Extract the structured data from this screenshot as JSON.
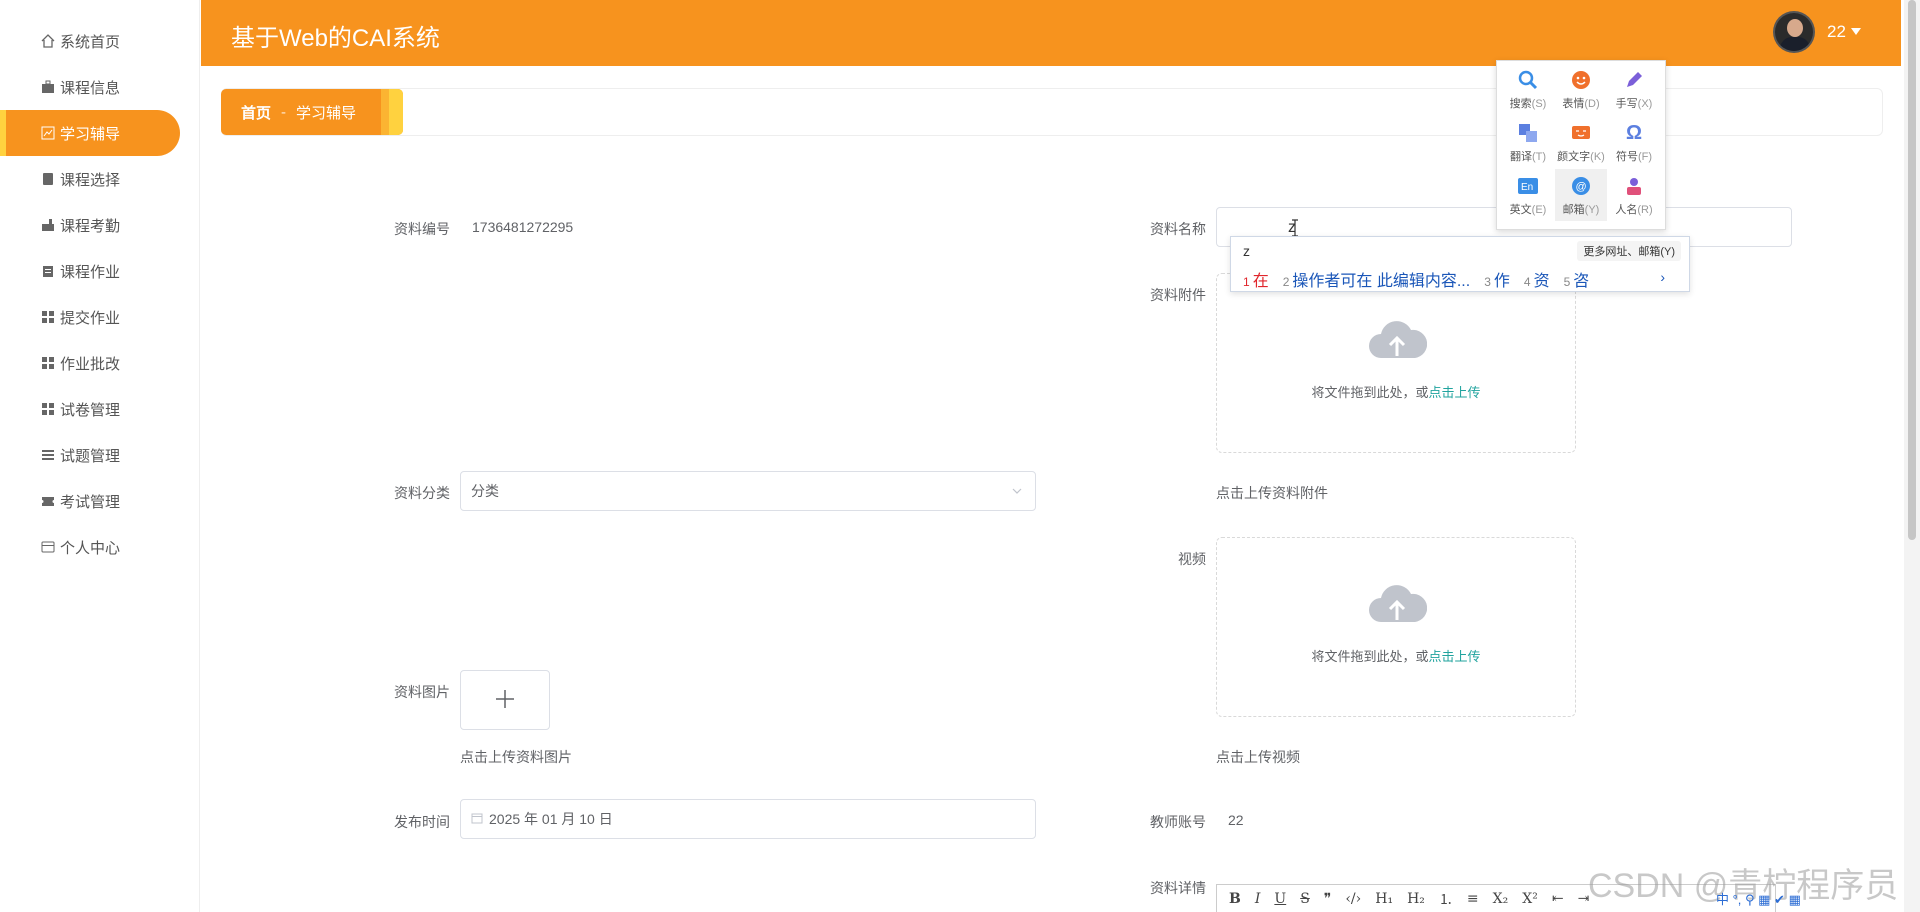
{
  "app": {
    "title": "基于Web的CAI系统",
    "username": "22"
  },
  "sidebar": {
    "items": [
      {
        "label": "系统首页",
        "icon": "home-icon"
      },
      {
        "label": "课程信息",
        "icon": "briefcase-icon"
      },
      {
        "label": "学习辅导",
        "icon": "chart-icon",
        "active": true
      },
      {
        "label": "课程选择",
        "icon": "book-icon"
      },
      {
        "label": "课程考勤",
        "icon": "stamp-icon"
      },
      {
        "label": "课程作业",
        "icon": "clipboard-icon"
      },
      {
        "label": "提交作业",
        "icon": "grid-icon"
      },
      {
        "label": "作业批改",
        "icon": "grid-icon"
      },
      {
        "label": "试卷管理",
        "icon": "grid-icon"
      },
      {
        "label": "试题管理",
        "icon": "list-icon"
      },
      {
        "label": "考试管理",
        "icon": "ticket-icon"
      },
      {
        "label": "个人中心",
        "icon": "card-icon"
      }
    ]
  },
  "breadcrumb": {
    "home": "首页",
    "separator": "-",
    "current": "学习辅导"
  },
  "form": {
    "code_label": "资料编号",
    "code_value": "1736481272295",
    "name_label": "资料名称",
    "name_value": "z",
    "attachment_label": "资料附件",
    "upload_text": "将文件拖到此处，或",
    "upload_link": "点击上传",
    "attachment_hint": "点击上传资料附件",
    "category_label": "资料分类",
    "category_value": "分类",
    "video_label": "视频",
    "video_hint": "点击上传视频",
    "image_label": "资料图片",
    "image_hint": "点击上传资料图片",
    "publish_label": "发布时间",
    "publish_value": "2025 年 01 月 10 日",
    "teacher_label": "教师账号",
    "teacher_value": "22",
    "detail_label": "资料详情"
  },
  "toolbar": {
    "bold": "B",
    "italic": "I",
    "underline": "U",
    "strike": "S",
    "quote": "❞",
    "code": "‹/›",
    "h1": "H₁",
    "h2": "H₂",
    "ol": "⒈",
    "ul": "≡",
    "sub": "X₂",
    "sup": "X²",
    "outdent": "⇤",
    "indent": "⇥"
  },
  "ime": {
    "panel": [
      {
        "label": "搜索",
        "key": "(S)",
        "icon": "search-icon",
        "color": "#3a8ee6"
      },
      {
        "label": "表情",
        "key": "(D)",
        "icon": "smile-icon",
        "color": "#f0702c"
      },
      {
        "label": "手写",
        "key": "(X)",
        "icon": "pen-icon",
        "color": "#7b5fd9"
      },
      {
        "label": "翻译",
        "key": "(T)",
        "icon": "translate-icon",
        "color": "#5b7fe0"
      },
      {
        "label": "颜文字",
        "key": "(K)",
        "icon": "kaomoji-icon",
        "color": "#f0702c"
      },
      {
        "label": "符号",
        "key": "(F)",
        "icon": "omega-icon",
        "color": "#5b7fe0"
      },
      {
        "label": "英文",
        "key": "(E)",
        "icon": "english-icon",
        "color": "#3a8ee6"
      },
      {
        "label": "邮箱",
        "key": "(Y)",
        "icon": "at-icon",
        "color": "#3a8ee6"
      },
      {
        "label": "人名",
        "key": "(R)",
        "icon": "person-icon",
        "color": "#e0507a"
      }
    ],
    "pinyin": "z",
    "more": "更多网址、邮箱(Y)",
    "candidates": [
      {
        "n": "1",
        "text": "在"
      },
      {
        "n": "2",
        "text": "操作者可在  此编辑内容..."
      },
      {
        "n": "3",
        "text": "作"
      },
      {
        "n": "4",
        "text": "资"
      },
      {
        "n": "5",
        "text": "咨"
      }
    ]
  },
  "watermark": "CSDN @青柠程序员",
  "tray": "中 °, ⚲ ▦ ✔ ▦"
}
